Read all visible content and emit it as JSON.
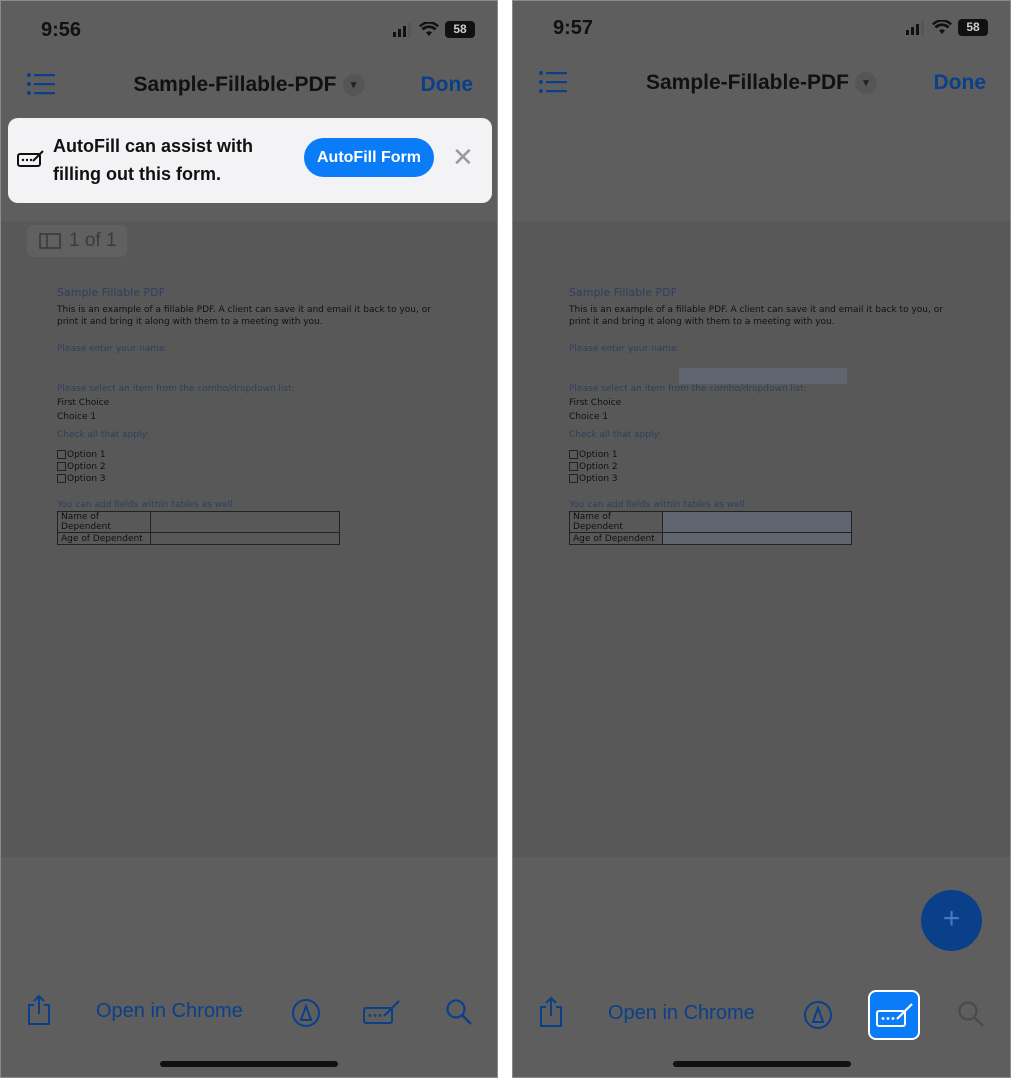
{
  "left": {
    "time": "9:56",
    "battery": "58",
    "nav": {
      "title": "Sample-Fillable-PDF",
      "done": "Done"
    },
    "banner": {
      "text": "AutoFill can assist with filling out this form.",
      "button": "AutoFill Form"
    },
    "page_badge": "1 of 1",
    "toolbar": {
      "open_label": "Open in Chrome"
    }
  },
  "right": {
    "time": "9:57",
    "battery": "58",
    "nav": {
      "title": "Sample-Fillable-PDF",
      "done": "Done"
    },
    "toolbar": {
      "open_label": "Open in Chrome"
    },
    "fab": "+"
  },
  "pdf": {
    "title": "Sample Fillable PDF",
    "intro": "This is an example of a fillable PDF. A client can save it and email it back to you, or print it and bring it along with them to a meeting with you.",
    "name_prompt": "Please enter your name:",
    "combo_prompt": "Please select an item from the combo/dropdown list:",
    "combo_label": "First Choice",
    "combo_value": "Choice 1",
    "check_prompt": "Check all that apply:",
    "options": [
      "Option 1",
      "Option 2",
      "Option 3"
    ],
    "table_prompt": "You can add  fields within tables as well:",
    "table_rows": [
      "Name of Dependent",
      "Age of Dependent"
    ]
  },
  "colors": {
    "accent": "#0a7cf8",
    "dim_accent": "#0a3f8a",
    "dim_bg": "#5e5e5e",
    "banner_bg": "#f3f3f5"
  }
}
